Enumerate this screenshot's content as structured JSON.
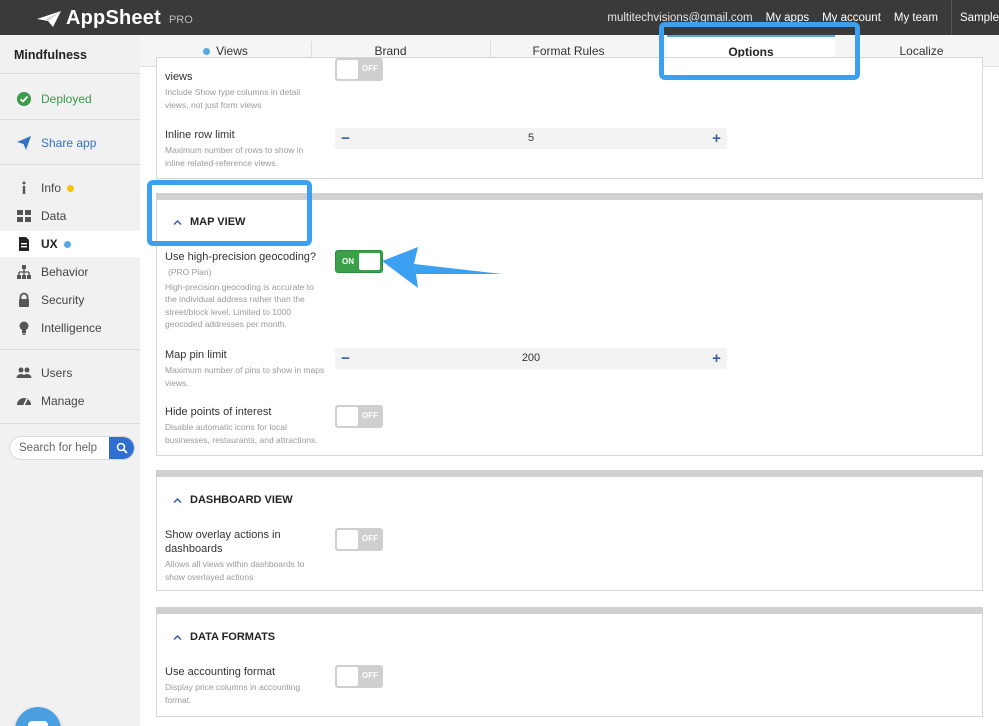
{
  "topbar": {
    "brand": "AppSheet",
    "plan": "PRO",
    "email": "multitechvisions@gmail.com",
    "links": [
      "My apps",
      "My account",
      "My team"
    ],
    "sample": "Sample"
  },
  "sidebar": {
    "app_name": "Mindfulness",
    "status": "Deployed",
    "share": "Share app",
    "items": [
      {
        "label": "Info",
        "icon": "info-icon"
      },
      {
        "label": "Data",
        "icon": "grid-icon"
      },
      {
        "label": "UX",
        "icon": "document-icon"
      },
      {
        "label": "Behavior",
        "icon": "hierarchy-icon"
      },
      {
        "label": "Security",
        "icon": "lock-icon"
      },
      {
        "label": "Intelligence",
        "icon": "bulb-icon"
      }
    ],
    "users": "Users",
    "manage": "Manage",
    "search_placeholder": "Search for help"
  },
  "tabs": [
    {
      "label": "Views"
    },
    {
      "label": "Brand"
    },
    {
      "label": "Format Rules"
    },
    {
      "label": "Options"
    },
    {
      "label": "Localize"
    }
  ],
  "top_card": {
    "partial_label": "views",
    "partial_sub": "Include Show type columns in detail views, not just form views",
    "partial_toggle": "OFF",
    "inline_label": "Inline row limit",
    "inline_sub": "Maximum number of rows to show in inline related-reference views.",
    "inline_value": "5"
  },
  "map_view": {
    "title": "MAP VIEW",
    "geocoding_label": "Use high-precision geocoding?",
    "geocoding_plan": "(PRO Plan)",
    "geocoding_sub": "High-precision geocoding is accurate to the individual address rather than the street/block level. Limited to 1000 geocoded addresses per month.",
    "geocoding_toggle": "ON",
    "pin_label": "Map pin limit",
    "pin_sub": "Maximum number of pins to show in maps views.",
    "pin_value": "200",
    "poi_label": "Hide points of interest",
    "poi_sub": "Disable automatic icons for local businesses, restaurants, and attractions.",
    "poi_toggle": "OFF"
  },
  "dashboard_view": {
    "title": "DASHBOARD VIEW",
    "overlay_label": "Show overlay actions in dashboards",
    "overlay_sub": "Allows all views within dashboards to show overlayed actions",
    "overlay_toggle": "OFF"
  },
  "data_formats": {
    "title": "DATA FORMATS",
    "accounting_label": "Use accounting format",
    "accounting_sub": "Display price columns in accounting format.",
    "accounting_toggle": "OFF"
  },
  "colors": {
    "highlight": "#3ba0f0",
    "toggle_on": "#3aa14a",
    "toggle_off": "#cfcfcf",
    "topbar": "#3a3a3a"
  }
}
